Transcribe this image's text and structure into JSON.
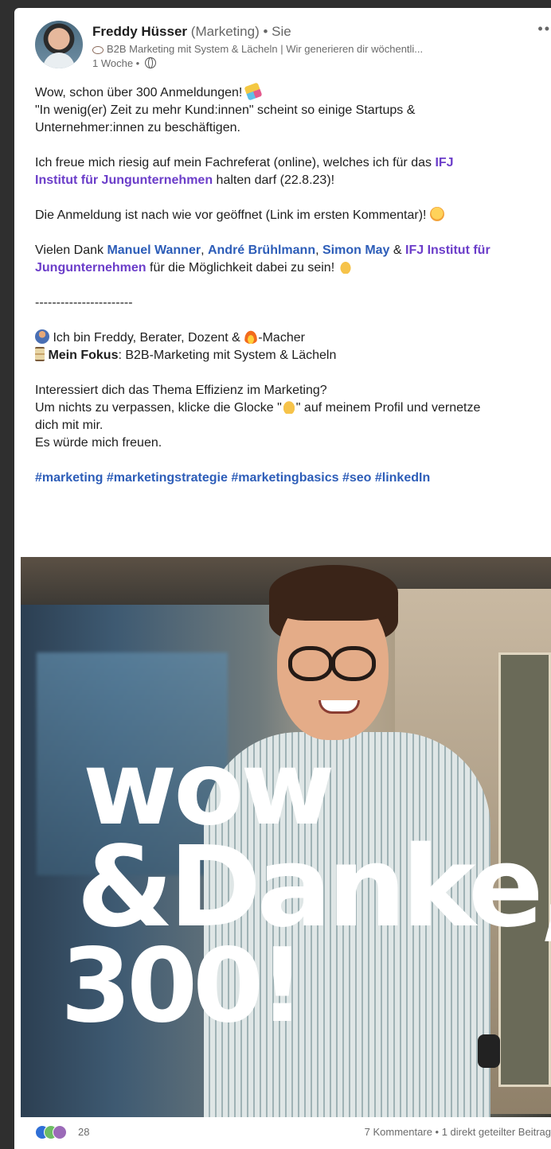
{
  "post": {
    "author": "Freddy Hüsser",
    "author_role": "(Marketing)",
    "relation": "• Sie",
    "tagline": "B2B Marketing mit System & Lächeln | Wir generieren dir wöchentli...",
    "time": "1 Woche •",
    "more_icon": "more-dots-icon"
  },
  "body": {
    "l1": "Wow, schon über 300 Anmeldungen!",
    "l2": "\"In wenig(er) Zeit zu mehr Kund:innen\" scheint so einige Startups &",
    "l3": "Unternehmer:innen zu beschäftigen.",
    "l4a": "Ich freue mich riesig auf mein Fachreferat (online), welches ich für das ",
    "l4_link": "IFJ",
    "l5_link": "Institut für Jungunternehmen",
    "l5b": " halten darf (22.8.23)!",
    "l6": "Die Anmeldung ist nach wie vor geöffnet (Link im ersten Kommentar)!",
    "l7a": "Vielen Dank ",
    "m1": "Manuel Wanner",
    "comma1": ", ",
    "m2": "André Brühlmann",
    "comma2": ", ",
    "m3": "Simon May",
    "amp": " & ",
    "m4": "IFJ Institut für",
    "m4b": "Jungunternehmen",
    "l8b": " für die Möglichkeit dabei zu sein!",
    "divider": "-----------------------",
    "l9a": " Ich bin Freddy, Berater, Dozent & ",
    "l9b": "-Macher",
    "l10_strong": "Mein Fokus",
    "l10": ": B2B-Marketing mit System & Lächeln",
    "l11": "Interessiert dich das Thema Effizienz im Marketing?",
    "l12a": "Um nichts zu verpassen, klicke die Glocke \"",
    "l12b": "\" auf meinem Profil und vernetze",
    "l13": "dich mit mir.",
    "l14": "Es würde mich freuen.",
    "hashtags": "#marketing #marketingstrategie #marketingbasics #seo #linkedIn"
  },
  "image": {
    "line1": "wow",
    "line2": "&Danke,",
    "line3": "300!"
  },
  "footer": {
    "reactions": "28",
    "comments": "7 Kommentare • 1 direkt geteilter Beitrag"
  }
}
